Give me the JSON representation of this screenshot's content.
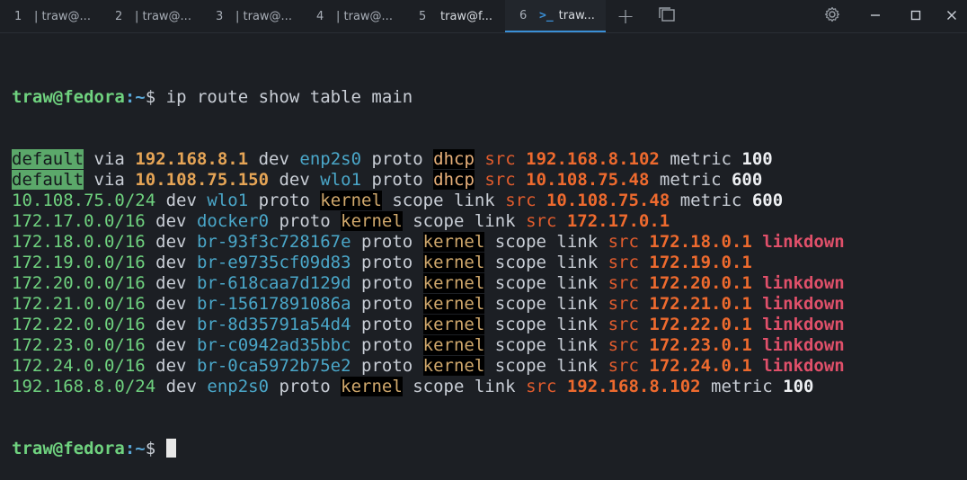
{
  "tabs": [
    {
      "num": "1",
      "title": "| traw@..."
    },
    {
      "num": "2",
      "title": "| traw@..."
    },
    {
      "num": "3",
      "title": "| traw@..."
    },
    {
      "num": "4",
      "title": "| traw@..."
    },
    {
      "num": "5",
      "title": "traw@f..."
    },
    {
      "num": "6",
      "title": "traw..."
    }
  ],
  "toolbar": {
    "new_tab_glyph": "+",
    "tab_overview_glyph": "❐",
    "settings_glyph": "⚙",
    "minimize_glyph": "—",
    "maximize_glyph": "☐",
    "close_glyph": "✕"
  },
  "prompt": {
    "user": "traw@fedora",
    "path": ":~",
    "symbol": "$ "
  },
  "command": "ip route show table main",
  "routes": [
    {
      "kind": "default",
      "via": "192.168.8.1",
      "dev": "enp2s0",
      "proto": "dhcp",
      "src": "192.168.8.102",
      "metric": "100"
    },
    {
      "kind": "default",
      "via": "10.108.75.150",
      "dev": "wlo1",
      "proto": "dhcp",
      "src": "10.108.75.48",
      "metric": "600"
    },
    {
      "kind": "net",
      "dest": "10.108.75.0/24",
      "dev": "wlo1",
      "proto": "kernel",
      "src": "10.108.75.48",
      "metric": "600"
    },
    {
      "kind": "net",
      "dest": "172.17.0.0/16",
      "dev": "docker0",
      "proto": "kernel",
      "src": "172.17.0.1"
    },
    {
      "kind": "net",
      "dest": "172.18.0.0/16",
      "dev": "br-93f3c728167e",
      "proto": "kernel",
      "src": "172.18.0.1",
      "flag": "linkdown"
    },
    {
      "kind": "net",
      "dest": "172.19.0.0/16",
      "dev": "br-e9735cf09d83",
      "proto": "kernel",
      "src": "172.19.0.1"
    },
    {
      "kind": "net",
      "dest": "172.20.0.0/16",
      "dev": "br-618caa7d129d",
      "proto": "kernel",
      "src": "172.20.0.1",
      "flag": "linkdown"
    },
    {
      "kind": "net",
      "dest": "172.21.0.0/16",
      "dev": "br-15617891086a",
      "proto": "kernel",
      "src": "172.21.0.1",
      "flag": "linkdown"
    },
    {
      "kind": "net",
      "dest": "172.22.0.0/16",
      "dev": "br-8d35791a54d4",
      "proto": "kernel",
      "src": "172.22.0.1",
      "flag": "linkdown"
    },
    {
      "kind": "net",
      "dest": "172.23.0.0/16",
      "dev": "br-c0942ad35bbc",
      "proto": "kernel",
      "src": "172.23.0.1",
      "flag": "linkdown"
    },
    {
      "kind": "net",
      "dest": "172.24.0.0/16",
      "dev": "br-0ca5972b75e2",
      "proto": "kernel",
      "src": "172.24.0.1",
      "flag": "linkdown"
    },
    {
      "kind": "net",
      "dest": "192.168.8.0/24",
      "dev": "enp2s0",
      "proto": "kernel",
      "src": "192.168.8.102",
      "metric": "100"
    }
  ],
  "keywords": {
    "via": "via",
    "dev": "dev",
    "proto": "proto",
    "scope_link": "scope link",
    "src": "src",
    "metric": "metric"
  }
}
